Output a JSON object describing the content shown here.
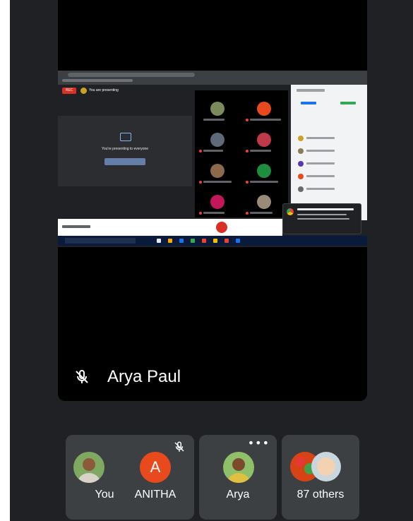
{
  "page_edge": {
    "top_char": "n",
    "bottom_char": "."
  },
  "presenting_screen": {
    "rec_badge": "REC",
    "presenting_label": "You are presenting",
    "panel_text": "You're presenting to everyone"
  },
  "presenter": {
    "name": "Arya Paul",
    "muted": true
  },
  "participants": [
    {
      "name": "You",
      "muted": true
    },
    {
      "name": "ANITHA",
      "initial": "A",
      "muted": true,
      "avatar_color": "#e8491d"
    },
    {
      "name": "Arya",
      "more_options": "•••"
    },
    {
      "name": "87 others"
    }
  ],
  "colors": {
    "background": "#202124",
    "tile": "#3c4043",
    "main_tile": "#000000",
    "end_call": "#d93025"
  }
}
